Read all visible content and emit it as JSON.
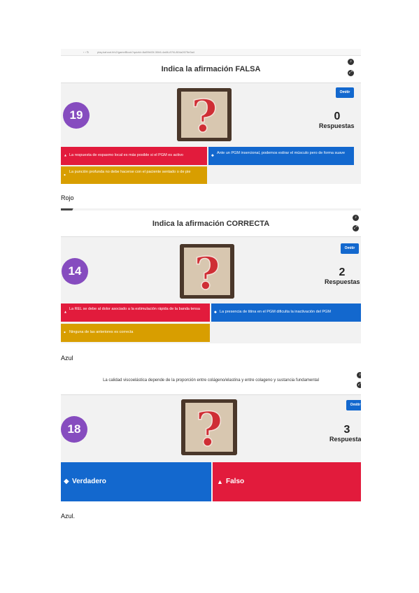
{
  "slides": [
    {
      "url": "play.kahoot.it/v2/gameBlock?quizId=8a59b03f-30b5-4a66-87f4-804a2675e3a4",
      "question": "Indica la afirmación FALSA",
      "skip_label": "Omitir",
      "timer": "19",
      "answer_count": "0",
      "answer_label": "Respuestas",
      "answers": [
        {
          "color": "red",
          "shape": "triangle",
          "text": "La respuesta de espasmo local es más posible si el PGM es activo"
        },
        {
          "color": "blue",
          "shape": "diamond",
          "text": "Ante un PGM insercional, podemos estirar el músculo pero de forma suave"
        },
        {
          "color": "yellow",
          "shape": "circle",
          "text": "La punción profunda no debe hacerse con el paciente sentado o de pie"
        }
      ],
      "caption": "Rojo"
    },
    {
      "question": "Indica la afirmación CORRECTA",
      "skip_label": "Omitir",
      "timer": "14",
      "answer_count": "2",
      "answer_label": "Respuestas",
      "answers": [
        {
          "color": "red",
          "shape": "triangle",
          "text": "La REL se debe al dolor asociado a la estimulación rápida de la banda tensa"
        },
        {
          "color": "blue",
          "shape": "diamond",
          "text": "La presencia de titina en el PGM dificulta la inactivación del PGM"
        },
        {
          "color": "yellow",
          "shape": "circle",
          "text": "Ninguna de las anteriores es correcta"
        }
      ],
      "caption": "Azul"
    },
    {
      "question": "La calidad viscoelástica depende de la proporción entre colágeno/elastina y entre colageno y sustancia fundamental",
      "skip_label": "Omitir",
      "timer": "18",
      "answer_count": "3",
      "answer_label": "Respuestas",
      "answers": [
        {
          "color": "blue",
          "shape": "diamond",
          "text": "Verdadero"
        },
        {
          "color": "red",
          "shape": "triangle",
          "text": "Falso"
        }
      ],
      "caption": "Azul."
    }
  ],
  "colors": {
    "red": "#e21b3c",
    "blue": "#1368ce",
    "yellow": "#d89e00",
    "purple": "#864cbf"
  },
  "icons": {
    "triangle": "▲",
    "diamond": "◆",
    "circle": "●"
  }
}
